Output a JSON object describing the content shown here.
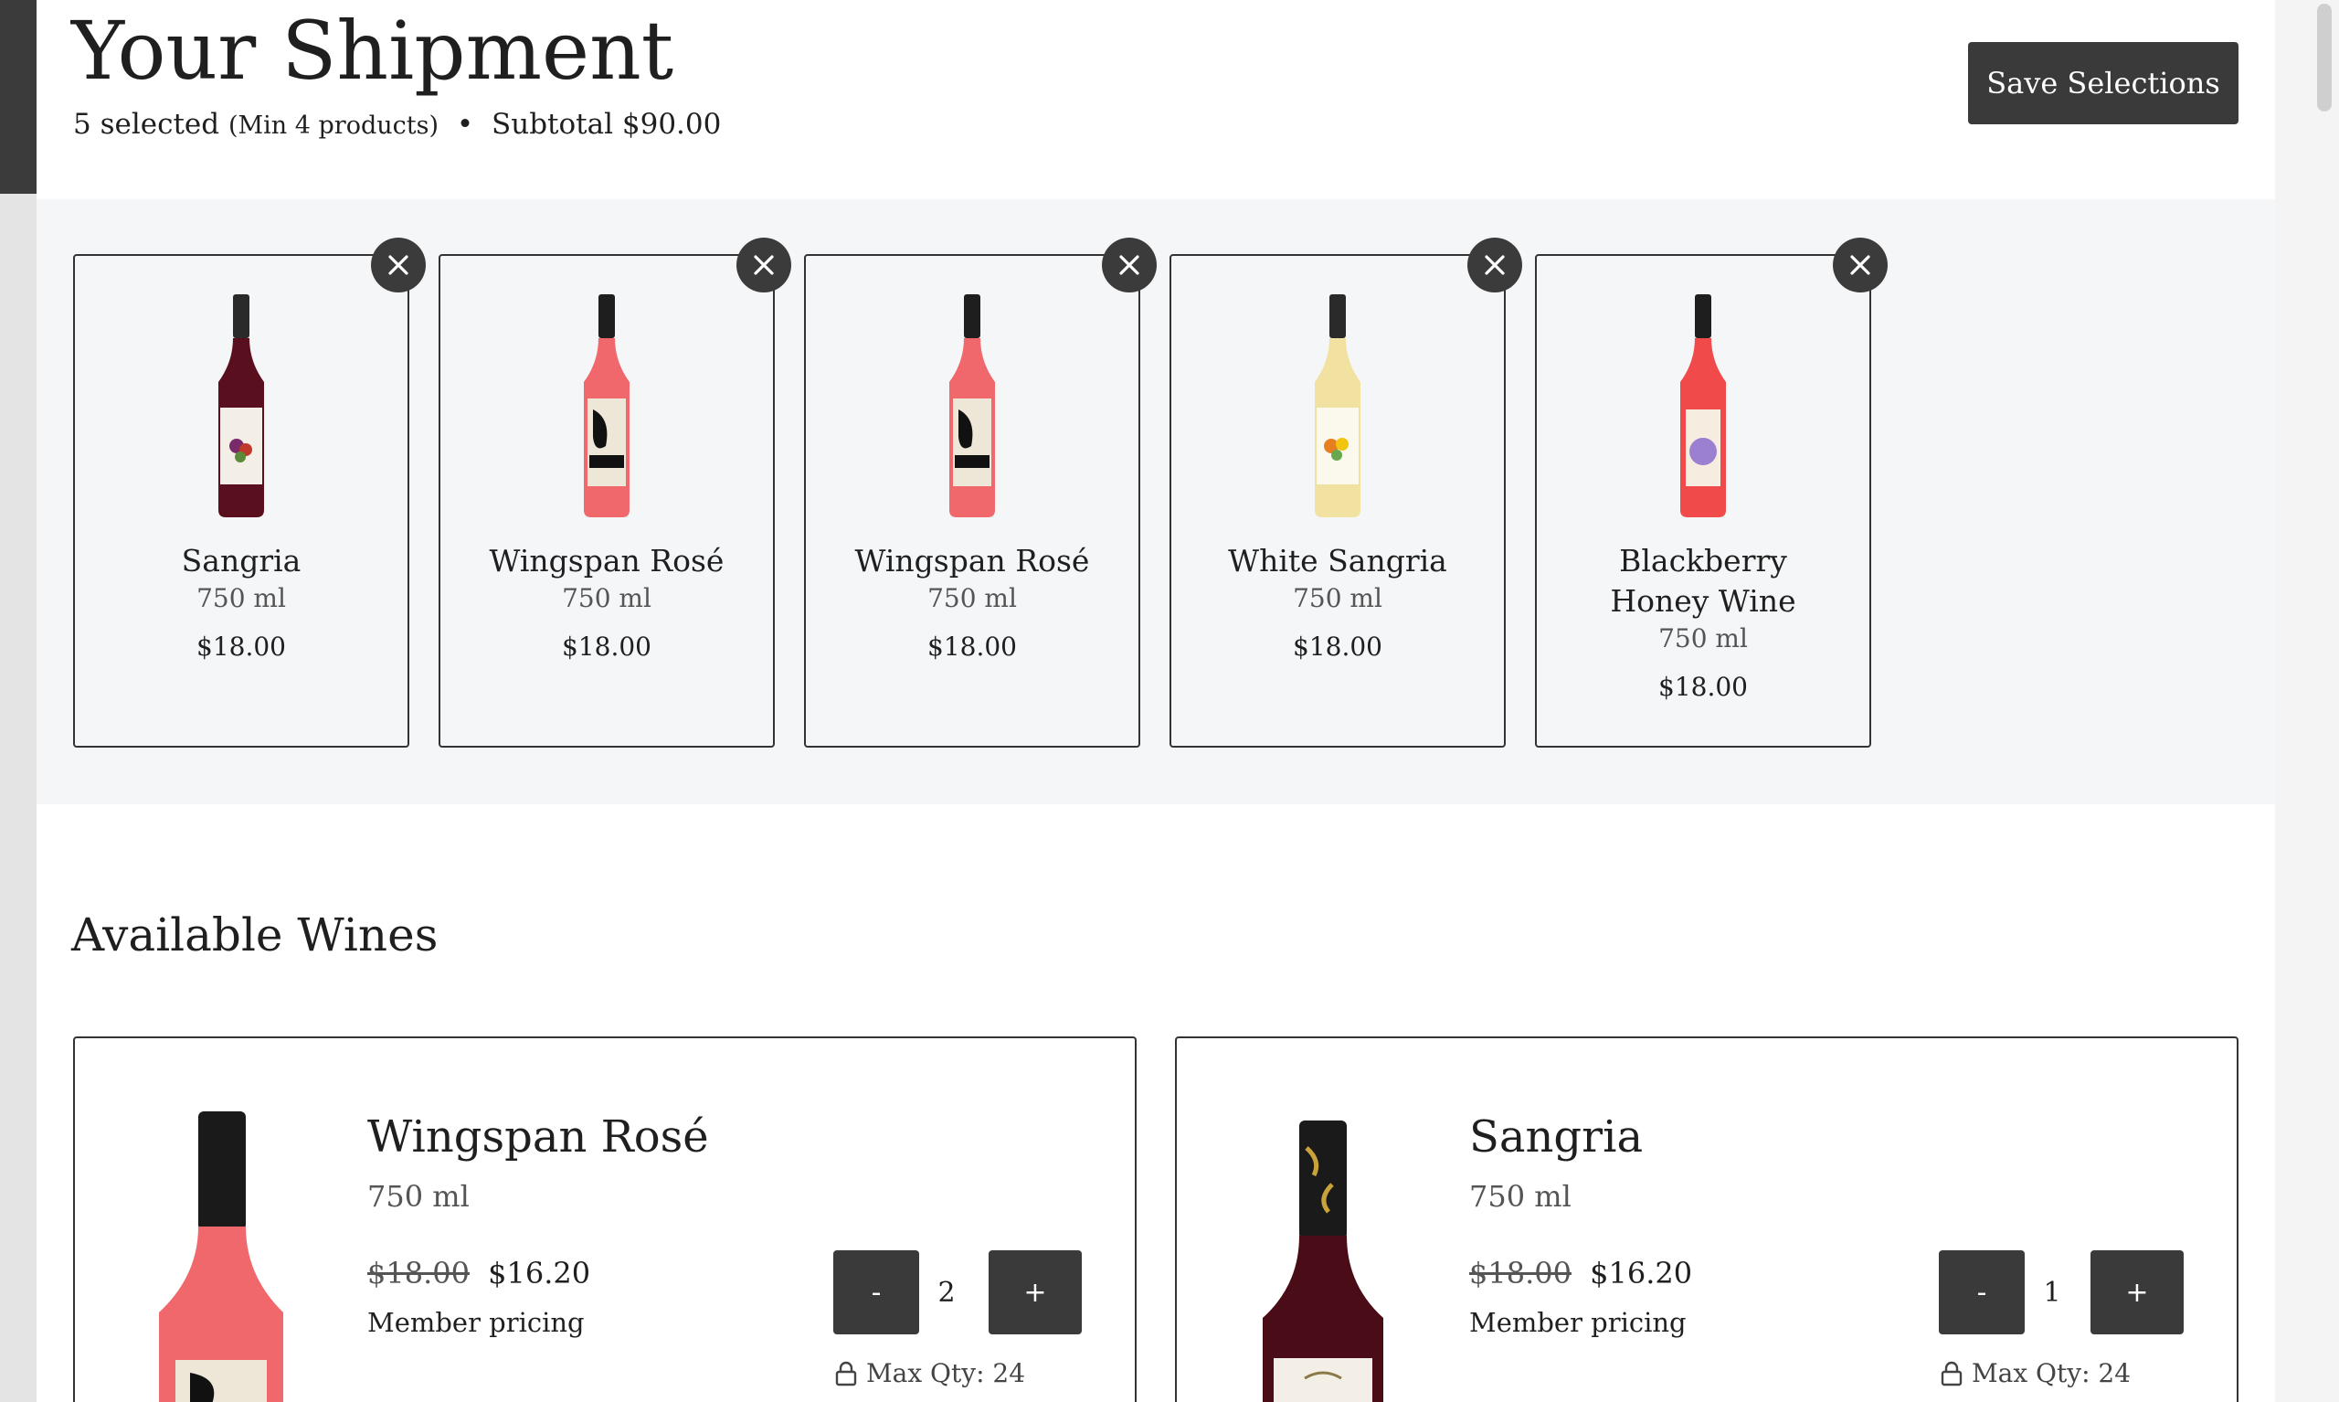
{
  "header": {
    "title": "Your Shipment",
    "selected_count": "5 selected",
    "minimum": "(Min 4 products)",
    "separator": "•",
    "subtotal": "Subtotal $90.00",
    "save_label": "Save Selections"
  },
  "selected": [
    {
      "name": "Sangria",
      "size": "750 ml",
      "price": "$18.00",
      "bottle_color": "#5a0f1e"
    },
    {
      "name": "Wingspan Rosé",
      "size": "750 ml",
      "price": "$18.00",
      "bottle_color": "#f0676c"
    },
    {
      "name": "Wingspan Rosé",
      "size": "750 ml",
      "price": "$18.00",
      "bottle_color": "#f0676c"
    },
    {
      "name": "White Sangria",
      "size": "750 ml",
      "price": "$18.00",
      "bottle_color": "#f2e2a2"
    },
    {
      "name": "Blackberry Honey Wine",
      "size": "750 ml",
      "price": "$18.00",
      "bottle_color": "#f04a4a"
    }
  ],
  "available": {
    "title": "Available Wines",
    "items": [
      {
        "name": "Wingspan Rosé",
        "size": "750 ml",
        "old_price": "$18.00",
        "price": "$16.20",
        "member_label": "Member pricing",
        "qty": "2",
        "minus": "-",
        "plus": "+",
        "max_qty": "Max Qty: 24",
        "bottle_color": "#f0676c"
      },
      {
        "name": "Sangria",
        "size": "750 ml",
        "old_price": "$18.00",
        "price": "$16.20",
        "member_label": "Member pricing",
        "qty": "1",
        "minus": "-",
        "plus": "+",
        "max_qty": "Max Qty: 24",
        "bottle_color": "#4a0c16"
      }
    ]
  },
  "colors": {
    "dark": "#3a3a3a",
    "tray": "#f5f6f8"
  }
}
